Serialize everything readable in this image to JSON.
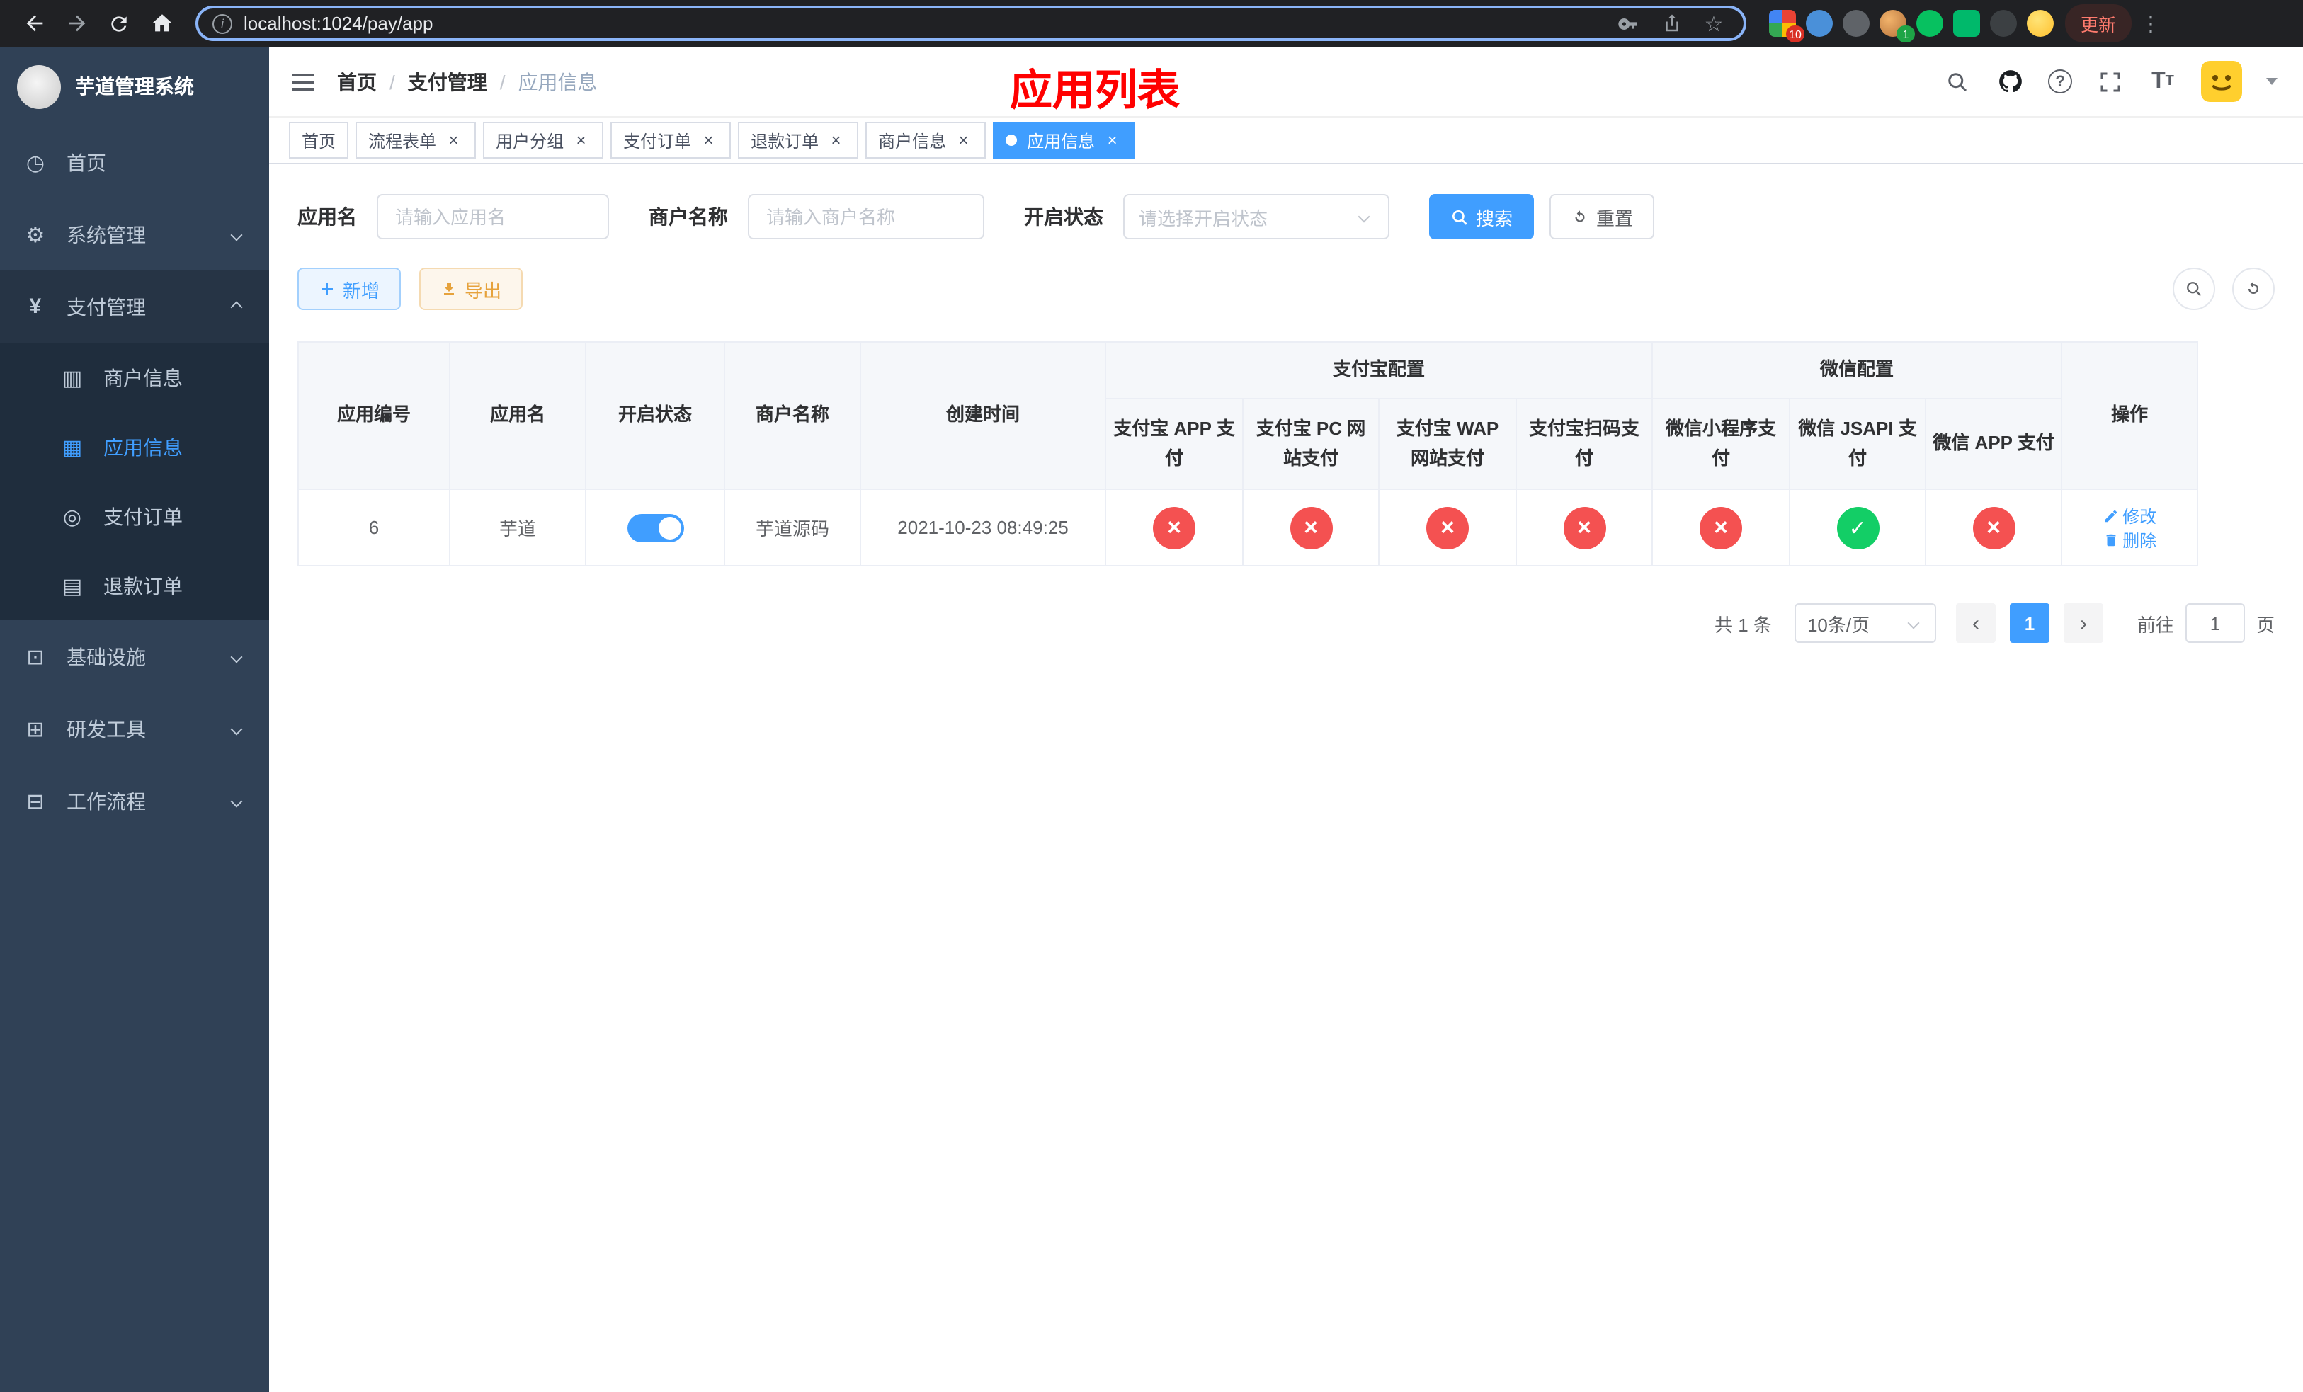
{
  "colors": {
    "accent": "#409eff",
    "danger": "#f45151",
    "success": "#13ce66",
    "warning": "#e6a23c",
    "banner_title": "#ff0000",
    "sidebar_bg": "#304156",
    "sidebar_submenu_bg": "#1f2d3d"
  },
  "browser": {
    "url": "localhost:1024/pay/app",
    "update_label": "更新",
    "extensions_badge": "10",
    "avatar_badge": "1"
  },
  "sidebar": {
    "title": "芋道管理系统",
    "items": [
      {
        "label": "首页"
      },
      {
        "label": "系统管理"
      },
      {
        "label": "支付管理",
        "children": [
          {
            "label": "商户信息"
          },
          {
            "label": "应用信息",
            "active": true
          },
          {
            "label": "支付订单"
          },
          {
            "label": "退款订单"
          }
        ]
      },
      {
        "label": "基础设施"
      },
      {
        "label": "研发工具"
      },
      {
        "label": "工作流程"
      }
    ]
  },
  "header": {
    "breadcrumb": [
      "首页",
      "支付管理",
      "应用信息"
    ],
    "banner_title": "应用列表"
  },
  "tabs": [
    {
      "label": "首页",
      "closable": false,
      "active": false
    },
    {
      "label": "流程表单",
      "closable": true,
      "active": false
    },
    {
      "label": "用户分组",
      "closable": true,
      "active": false
    },
    {
      "label": "支付订单",
      "closable": true,
      "active": false
    },
    {
      "label": "退款订单",
      "closable": true,
      "active": false
    },
    {
      "label": "商户信息",
      "closable": true,
      "active": false
    },
    {
      "label": "应用信息",
      "closable": true,
      "active": true
    }
  ],
  "filters": {
    "app_name_label": "应用名",
    "app_name_placeholder": "请输入应用名",
    "merchant_label": "商户名称",
    "merchant_placeholder": "请输入商户名称",
    "status_label": "开启状态",
    "status_placeholder": "请选择开启状态",
    "search_label": "搜索",
    "reset_label": "重置"
  },
  "toolbar": {
    "add_label": "新增",
    "export_label": "导出"
  },
  "table": {
    "group_alipay": "支付宝配置",
    "group_wechat": "微信配置",
    "columns": [
      "应用编号",
      "应用名",
      "开启状态",
      "商户名称",
      "创建时间",
      "支付宝 APP 支付",
      "支付宝 PC 网站支付",
      "支付宝 WAP 网站支付",
      "支付宝扫码支付",
      "微信小程序支付",
      "微信 JSAPI 支付",
      "微信 APP 支付",
      "操作"
    ],
    "rows": [
      {
        "id": "6",
        "name": "芋道",
        "enabled": true,
        "merchant": "芋道源码",
        "created": "2021-10-23 08:49:25",
        "configs": [
          "no",
          "no",
          "no",
          "no",
          "no",
          "yes",
          "no"
        ],
        "edit_label": "修改",
        "delete_label": "删除"
      }
    ]
  },
  "pagination": {
    "total": "共 1 条",
    "page_size": "10条/页",
    "page": "1",
    "goto_label": "前往",
    "goto_value": "1",
    "unit_label": "页"
  }
}
